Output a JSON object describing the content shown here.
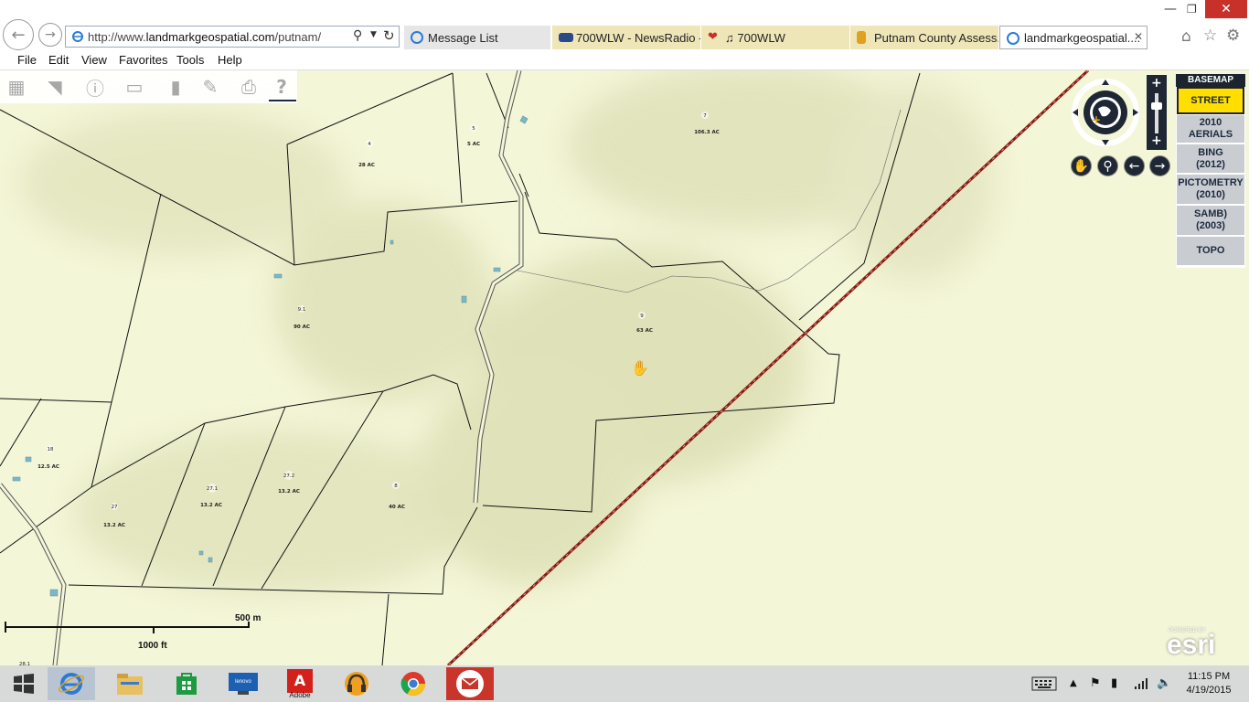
{
  "browser": {
    "url_prefix": "http://www.",
    "url_domain": "landmarkgeospatial.com",
    "url_path": "/putnam/",
    "tabs": [
      {
        "label": "Message List",
        "icon": "ie-page-icon"
      },
      {
        "label": "700WLW - NewsRadio -...",
        "icon": "wlw-icon"
      },
      {
        "label": "♫ 700WLW",
        "icon": "iheart-icon"
      },
      {
        "label": "Putnam County Assess...",
        "icon": "bookmark-icon"
      },
      {
        "label": "landmarkgeospatial....",
        "icon": "ie-page-icon"
      }
    ],
    "menu": [
      "File",
      "Edit",
      "View",
      "Favorites",
      "Tools",
      "Help"
    ]
  },
  "basemap": {
    "heading": "BASEMAP",
    "options": [
      {
        "line1": "STREET",
        "line2": "",
        "active": true
      },
      {
        "line1": "2010",
        "line2": "AERIALS",
        "active": false
      },
      {
        "line1": "BING",
        "line2": "(2012)",
        "active": false
      },
      {
        "line1": "PICTOMETRY",
        "line2": "(2010)",
        "active": false
      },
      {
        "line1": "SAMB)",
        "line2": "(2003)",
        "active": false
      },
      {
        "line1": "TOPO",
        "line2": "",
        "active": false
      }
    ]
  },
  "parcels": [
    {
      "id": "4",
      "area": "28 AC"
    },
    {
      "id": "5",
      "area": "5 AC"
    },
    {
      "id": "7",
      "area": "106.3 AC"
    },
    {
      "id": "9.1",
      "area": "90 AC"
    },
    {
      "id": "9",
      "area": "63 AC"
    },
    {
      "id": "18",
      "area": "12.5 AC"
    },
    {
      "id": "27",
      "area": "13.2 AC"
    },
    {
      "id": "27.1",
      "area": "13.2 AC"
    },
    {
      "id": "27.2",
      "area": "13.2 AC"
    },
    {
      "id": "8",
      "area": "40 AC"
    },
    {
      "id": "28.1",
      "area": ""
    }
  ],
  "scale": {
    "metric": "500 m",
    "imperial": "1000 ft"
  },
  "attribution": {
    "small": "POWERED BY",
    "logo": "esri"
  },
  "colors": {
    "map_bg": "#f4f6d8",
    "rail": "#8a1a14",
    "basemap_active": "#ffde00"
  },
  "taskbar": {
    "apps": [
      "windows-start-icon",
      "internet-explorer-icon",
      "file-explorer-icon",
      "store-icon",
      "lenovo-icon",
      "adobe-icon",
      "headphones-icon",
      "chrome-icon",
      "mail-icon"
    ],
    "adobe_label": "Adobe",
    "lenovo_label": "lenovo",
    "time": "11:15 PM",
    "date": "4/19/2015"
  }
}
